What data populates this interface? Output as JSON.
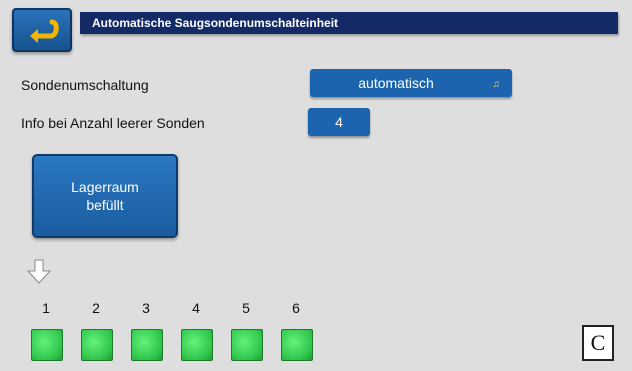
{
  "header": {
    "title": "Automatische Saugsondenumschalteinheit"
  },
  "settings": {
    "mode_label": "Sondenumschaltung",
    "mode_value": "automatisch",
    "empty_label": "Info bei Anzahl leerer Sonden",
    "empty_value": "4"
  },
  "storage_button": {
    "label": "Lagerraum\nbefüllt"
  },
  "probes": [
    "1",
    "2",
    "3",
    "4",
    "5",
    "6"
  ],
  "corner_button": {
    "label": "C"
  },
  "colors": {
    "title_bar": "#132a66",
    "button": "#1c64ae",
    "probe_active": "#35c94f",
    "background": "#dedede"
  }
}
